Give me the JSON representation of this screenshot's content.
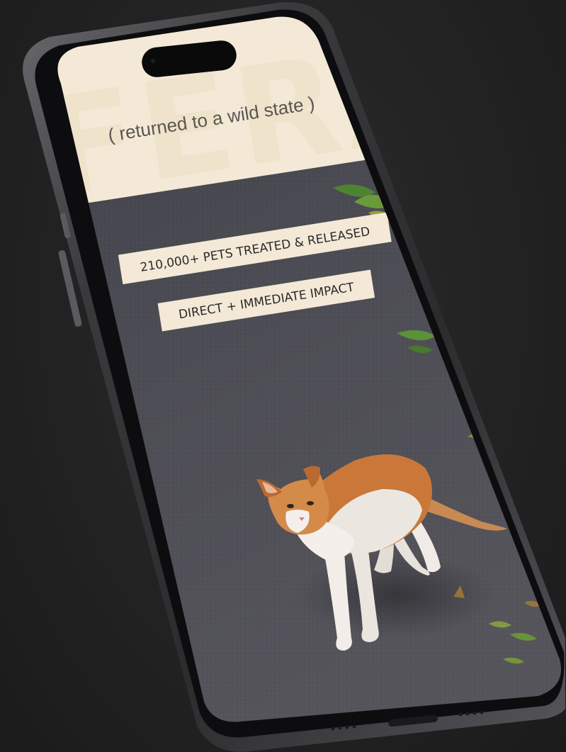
{
  "hero": {
    "word": "FERAL",
    "subtitle": "( returned to a wild state )"
  },
  "stats": {
    "pets_treated": "210,000+ PETS TREATED & RELEASED",
    "impact": "DIRECT + IMMEDIATE IMPACT"
  },
  "colors": {
    "cream": "#F3E9D6",
    "asphalt": "#4b4b52",
    "frame": "#2a2a2c",
    "accent_cat": "#c9783a"
  }
}
